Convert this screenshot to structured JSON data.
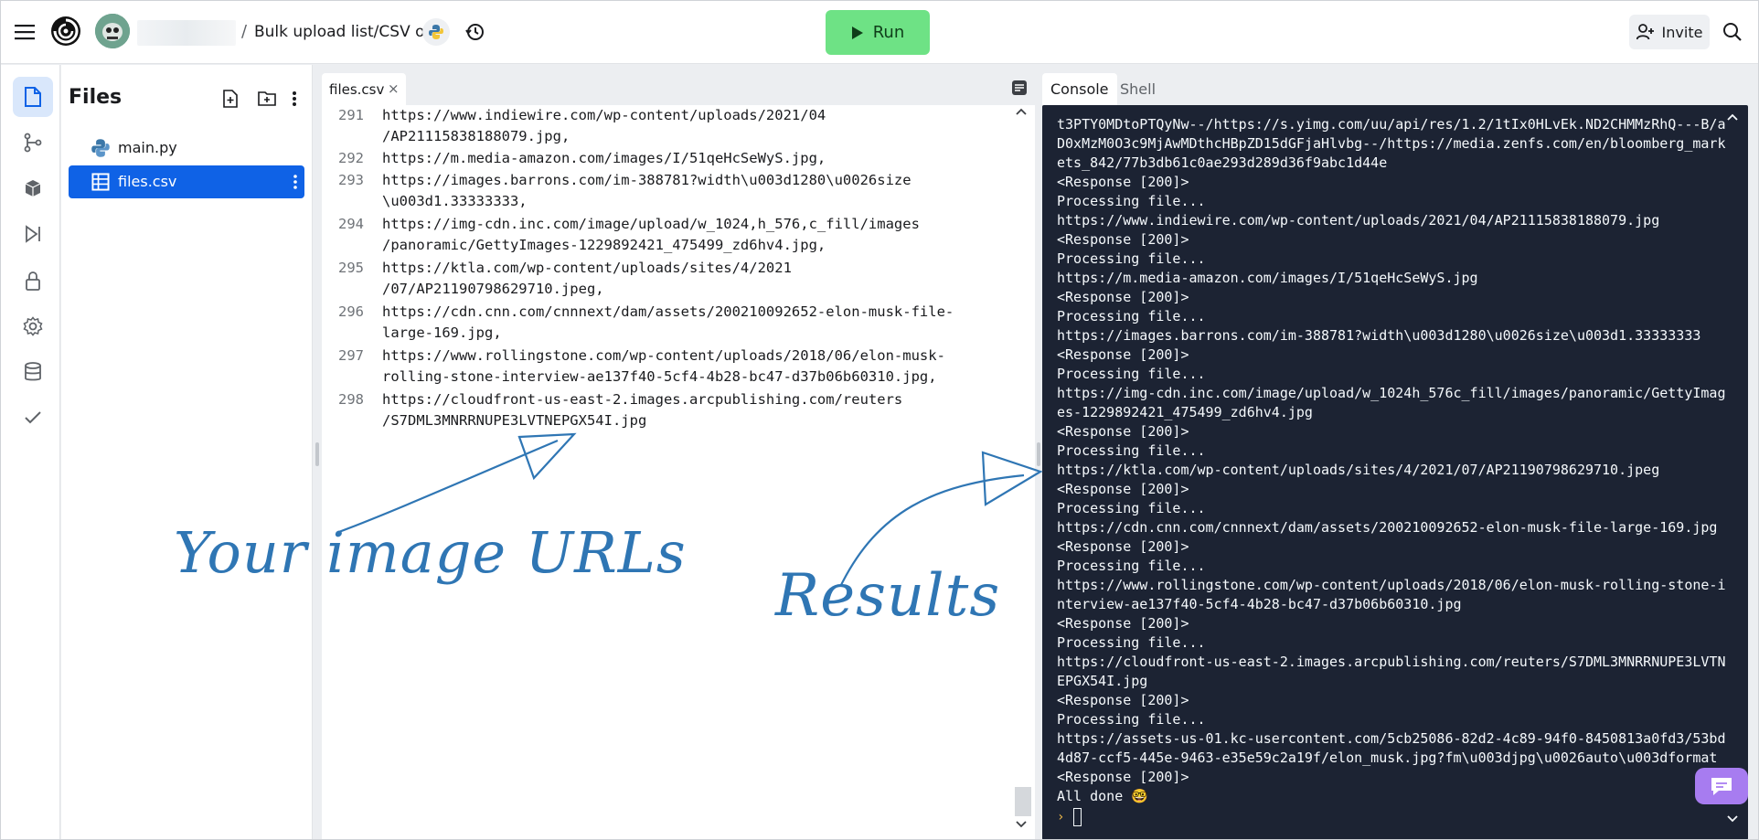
{
  "topbar": {
    "breadcrumb_separator": "/",
    "repl_name": "Bulk upload list/CSV o...",
    "run_label": "Run",
    "invite_label": "Invite",
    "icons": [
      "hamburger-icon",
      "replit-logo-icon",
      "avatar",
      "python-icon",
      "history-icon",
      "play-icon",
      "add-user-icon",
      "search-icon"
    ]
  },
  "sidebar": {
    "items": [
      "files-icon",
      "git-icon",
      "packages-icon",
      "debugger-icon",
      "secrets-icon",
      "settings-icon",
      "database-icon",
      "tests-icon"
    ]
  },
  "filetree": {
    "title": "Files",
    "files": [
      {
        "name": "main.py",
        "icon": "python-file-icon"
      },
      {
        "name": "files.csv",
        "icon": "table-file-icon",
        "selected": true
      }
    ]
  },
  "editor": {
    "tab_label": "files.csv",
    "close_glyph": "×",
    "lines": [
      {
        "num": "291",
        "text": [
          "https://www.indiewire.com/wp-content/uploads/2021/04",
          "/AP21115838188079.jpg,"
        ]
      },
      {
        "num": "292",
        "text": [
          "https://m.media-amazon.com/images/I/51qeHcSeWyS.jpg,"
        ]
      },
      {
        "num": "293",
        "text": [
          "https://images.barrons.com/im-388781?width\\u003d1280\\u0026size",
          "\\u003d1.33333333,"
        ]
      },
      {
        "num": "294",
        "text": [
          "https://img-cdn.inc.com/image/upload/w_1024,h_576,c_fill/images",
          "/panoramic/GettyImages-1229892421_475499_zd6hv4.jpg,"
        ]
      },
      {
        "num": "295",
        "text": [
          "https://ktla.com/wp-content/uploads/sites/4/2021",
          "/07/AP21190798629710.jpeg,"
        ]
      },
      {
        "num": "296",
        "text": [
          "https://cdn.cnn.com/cnnnext/dam/assets/200210092652-elon-musk-file-",
          "large-169.jpg,"
        ]
      },
      {
        "num": "297",
        "text": [
          "https://www.rollingstone.com/wp-content/uploads/2018/06/elon-musk-",
          "rolling-stone-interview-ae137f40-5cf4-4b28-bc47-d37b06b60310.jpg,"
        ]
      },
      {
        "num": "298",
        "text": [
          "https://cloudfront-us-east-2.images.arcpublishing.com/reuters",
          "/S7DML3MNRRNUPE3LVTNEPGX54I.jpg"
        ]
      }
    ]
  },
  "console": {
    "tabs": [
      "Console",
      "Shell"
    ],
    "lines": [
      "t3PTY0MDtoPTQyNw--/https://s.yimg.com/uu/api/res/1.2/1tIx0HLvEk.ND2CHMMzRhQ---B/a",
      "D0xMzM0O3c9MjAwMDthcHBpZD15dGFjaHlvbg--/https://media.zenfs.com/en/bloomberg_mark",
      "ets_842/77b3db61c0ae293d289d36f9abc1d44e",
      "<Response [200]>",
      "Processing file...",
      "https://www.indiewire.com/wp-content/uploads/2021/04/AP21115838188079.jpg",
      "<Response [200]>",
      "Processing file...",
      "https://m.media-amazon.com/images/I/51qeHcSeWyS.jpg",
      "<Response [200]>",
      "Processing file...",
      "https://images.barrons.com/im-388781?width\\u003d1280\\u0026size\\u003d1.33333333",
      "<Response [200]>",
      "Processing file...",
      "https://img-cdn.inc.com/image/upload/w_1024h_576c_fill/images/panoramic/GettyImag",
      "es-1229892421_475499_zd6hv4.jpg",
      "<Response [200]>",
      "Processing file...",
      "https://ktla.com/wp-content/uploads/sites/4/2021/07/AP21190798629710.jpeg",
      "<Response [200]>",
      "Processing file...",
      "https://cdn.cnn.com/cnnnext/dam/assets/200210092652-elon-musk-file-large-169.jpg",
      "<Response [200]>",
      "Processing file...",
      "https://www.rollingstone.com/wp-content/uploads/2018/06/elon-musk-rolling-stone-i",
      "nterview-ae137f40-5cf4-4b28-bc47-d37b06b60310.jpg",
      "<Response [200]>",
      "Processing file...",
      "https://cloudfront-us-east-2.images.arcpublishing.com/reuters/S7DML3MNRRNUPE3LVTN",
      "EPGX54I.jpg",
      "<Response [200]>",
      "Processing file...",
      "https://assets-us-01.kc-usercontent.com/5cb25086-82d2-4c89-94f0-8450813a0fd3/53bd",
      "4d87-ccf5-445e-9463-e35e59c2a19f/elon_musk.jpg?fm\\u003djpg\\u0026auto\\u003dformat",
      "<Response [200]>",
      "All done 🤓"
    ],
    "prompt_glyph": "›"
  },
  "annotations": {
    "left": "Your image URLs",
    "right": "Results"
  },
  "colors": {
    "run_green": "#6ee285",
    "selected_blue": "#0f62e6",
    "console_bg": "#1c2333",
    "annotation_blue": "#2f76b4",
    "chat_purple": "#a77cf0"
  }
}
